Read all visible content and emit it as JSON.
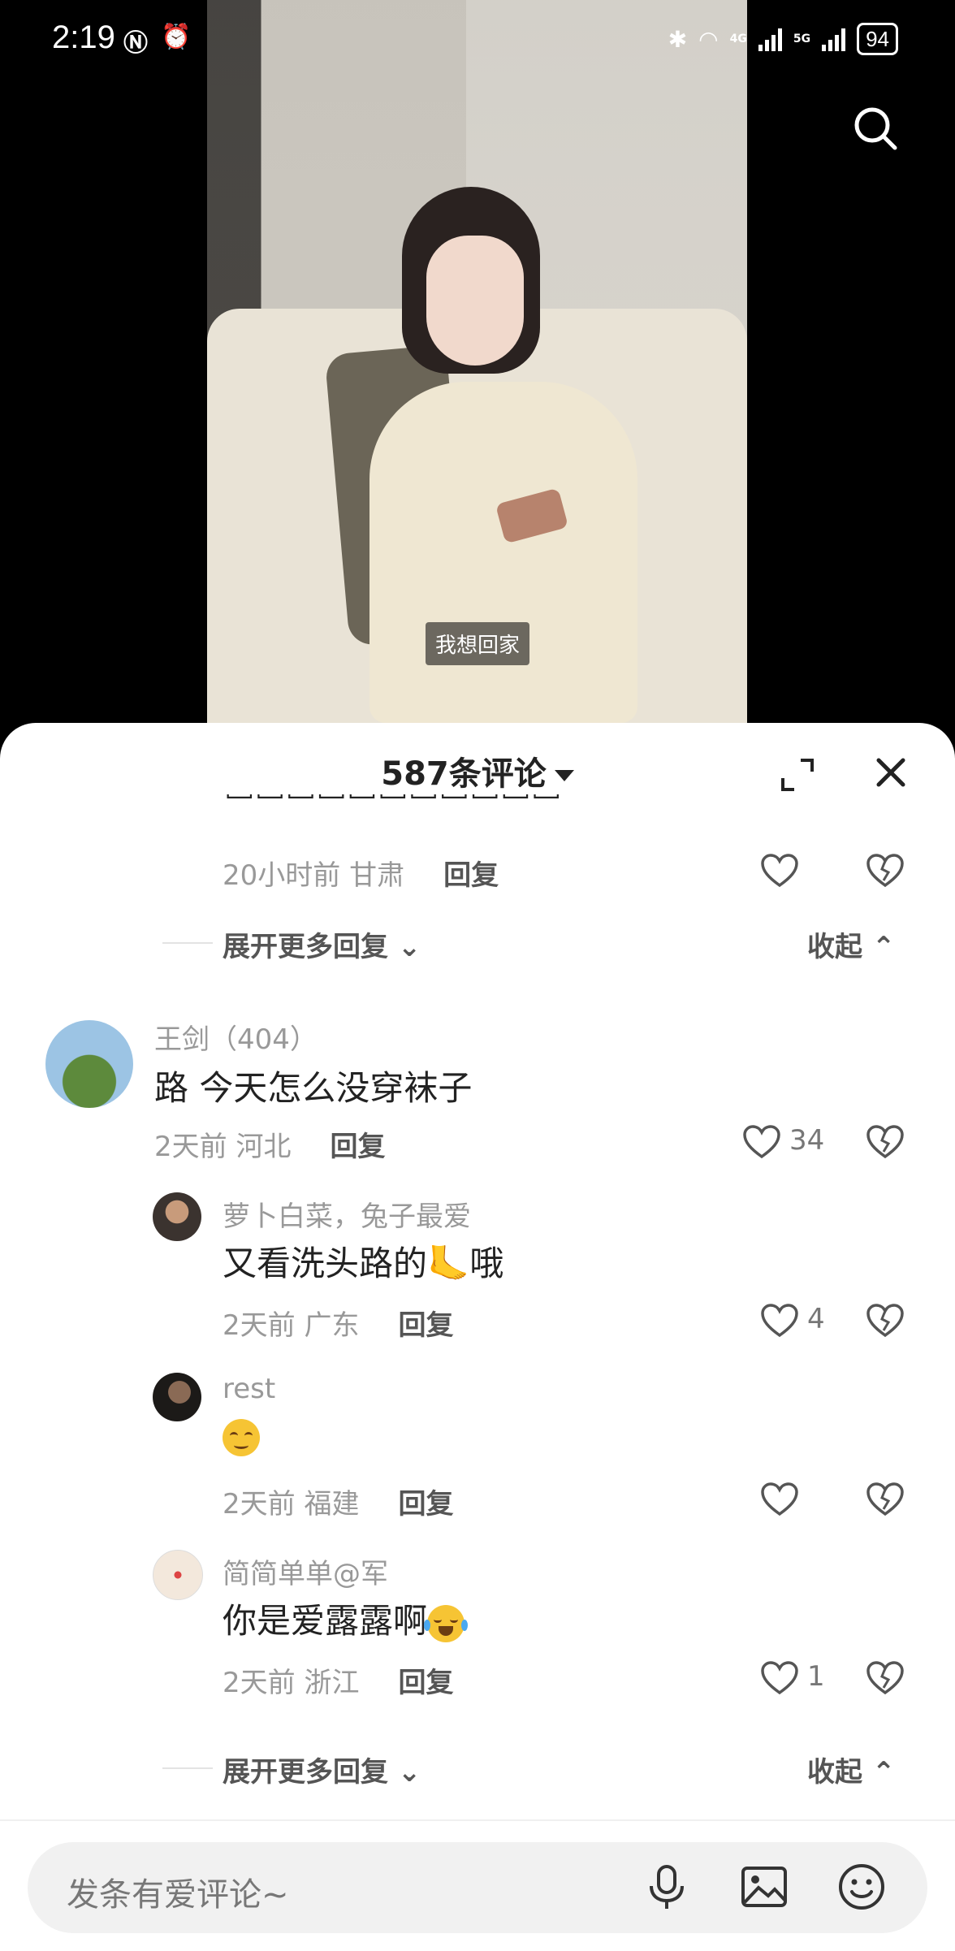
{
  "status_bar": {
    "time": "2:19",
    "net1": "4G",
    "net2": "5G",
    "battery": "94"
  },
  "video": {
    "caption": "我想回家"
  },
  "sheet": {
    "title": "587条评论"
  },
  "top_reply": {
    "time": "20小时前",
    "location": "甘肃",
    "reply": "回复"
  },
  "expand1": {
    "label": "展开更多回复",
    "collapse": "收起"
  },
  "comments": [
    {
      "user": "王剑（404）",
      "text": "路 今天怎么没穿袜子",
      "time": "2天前",
      "location": "河北",
      "reply": "回复",
      "likes": "34"
    },
    {
      "user": "萝卜白菜，兔子最爱",
      "text": "又看洗头路的",
      "text_suffix": "哦",
      "time": "2天前",
      "location": "广东",
      "reply": "回复",
      "likes": "4"
    },
    {
      "user": "rest",
      "text": "",
      "time": "2天前",
      "location": "福建",
      "reply": "回复",
      "likes": ""
    },
    {
      "user": "简简单单@军",
      "text": "你是爱露露啊",
      "time": "2天前",
      "location": "浙江",
      "reply": "回复",
      "likes": "1"
    }
  ],
  "expand2": {
    "label": "展开更多回复",
    "collapse": "收起"
  },
  "input": {
    "placeholder": "发条有爱评论~"
  },
  "icons": [
    "search-icon",
    "expand-icon",
    "close-icon",
    "heart-icon",
    "dislike-heart-icon",
    "mic-icon",
    "image-icon",
    "emoji-icon"
  ]
}
